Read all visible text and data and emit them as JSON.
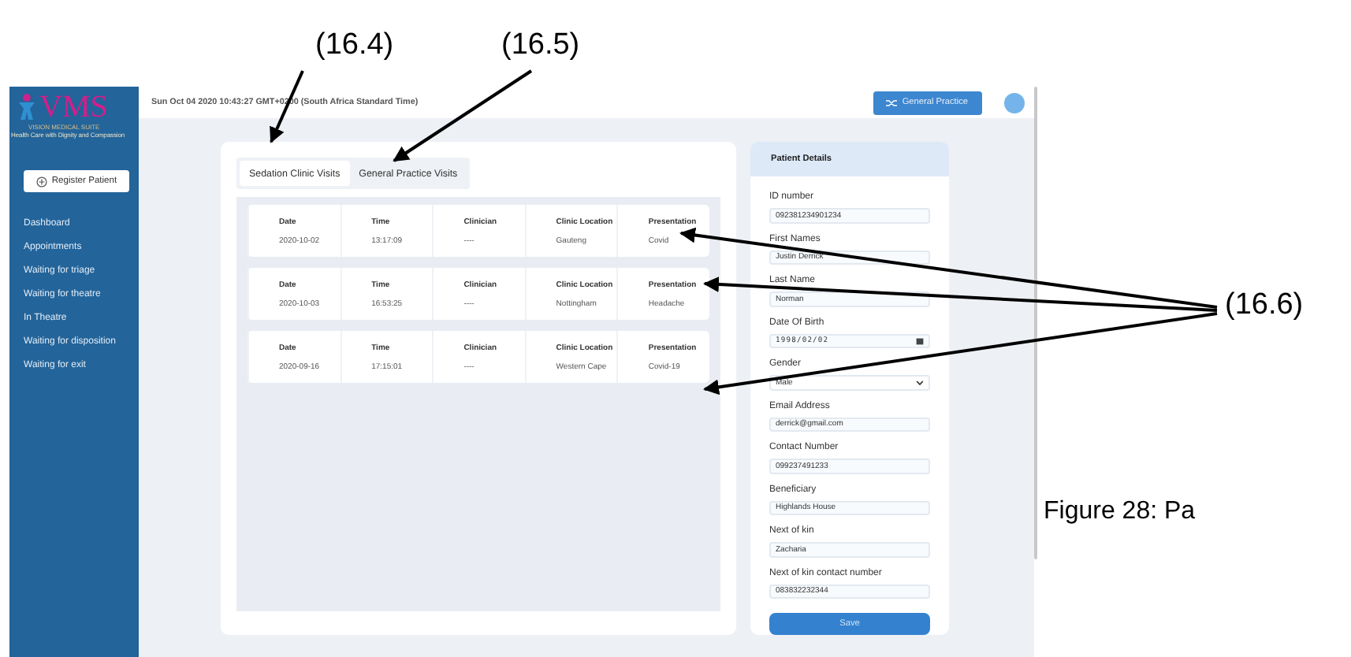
{
  "annotations": [
    {
      "label": "(16.4)"
    },
    {
      "label": "(16.5)"
    },
    {
      "label": "(16.6)"
    }
  ],
  "caption": "Figure 28: Pa",
  "sidebar": {
    "logo": "VMS",
    "logo_subtitle": "VISION MEDICAL SUITE",
    "tagline": "Health Care with Dignity and Compassion",
    "register_button": "Register Patient",
    "items": [
      {
        "label": "Dashboard"
      },
      {
        "label": "Appointments"
      },
      {
        "label": "Waiting for triage"
      },
      {
        "label": "Waiting for theatre"
      },
      {
        "label": "In Theatre"
      },
      {
        "label": "Waiting for disposition"
      },
      {
        "label": "Waiting for exit"
      }
    ]
  },
  "header": {
    "datetime": "Sun Oct 04 2020 10:43:27 GMT+0200 (South Africa Standard Time)",
    "practice_button": "General Practice"
  },
  "tabs": [
    {
      "label": "Sedation Clinic Visits",
      "selected": true
    },
    {
      "label": "General Practice Visits",
      "selected": false
    }
  ],
  "visits": [
    {
      "cells": [
        {
          "heading": "Date",
          "value": "2020-10-02"
        },
        {
          "heading": "Time",
          "value": "13:17:09"
        },
        {
          "heading": "Clinician",
          "value": "----"
        },
        {
          "heading": "Clinic Location",
          "value": "Gauteng"
        },
        {
          "heading": "Presentation",
          "value": "Covid"
        }
      ]
    },
    {
      "cells": [
        {
          "heading": "Date",
          "value": "2020-10-03"
        },
        {
          "heading": "Time",
          "value": "16:53:25"
        },
        {
          "heading": "Clinician",
          "value": "----"
        },
        {
          "heading": "Clinic Location",
          "value": "Nottingham"
        },
        {
          "heading": "Presentation",
          "value": "Headache"
        }
      ]
    },
    {
      "cells": [
        {
          "heading": "Date",
          "value": "2020-09-16"
        },
        {
          "heading": "Time",
          "value": "17:15:01"
        },
        {
          "heading": "Clinician",
          "value": "----"
        },
        {
          "heading": "Clinic Location",
          "value": "Western Cape"
        },
        {
          "heading": "Presentation",
          "value": "Covid-19"
        }
      ]
    }
  ],
  "patient_details": {
    "title": "Patient Details",
    "save_button": "Save",
    "fields": [
      {
        "kind": "text",
        "label": "ID number",
        "value": "092381234901234"
      },
      {
        "kind": "text",
        "label": "First Names",
        "value": "Justin Derrick"
      },
      {
        "kind": "text",
        "label": "Last Name",
        "value": "Norman"
      },
      {
        "kind": "date",
        "label": "Date Of Birth",
        "value": "1998/02/02"
      },
      {
        "kind": "select",
        "label": "Gender",
        "value": "Male"
      },
      {
        "kind": "text",
        "label": "Email Address",
        "value": "derrick@gmail.com"
      },
      {
        "kind": "text",
        "label": "Contact Number",
        "value": "099237491233"
      },
      {
        "kind": "text",
        "label": "Beneficiary",
        "value": "Highlands House"
      },
      {
        "kind": "text",
        "label": "Next of kin",
        "value": "Zacharia"
      },
      {
        "kind": "text",
        "label": "Next of kin contact number",
        "value": "083832232344"
      }
    ]
  }
}
